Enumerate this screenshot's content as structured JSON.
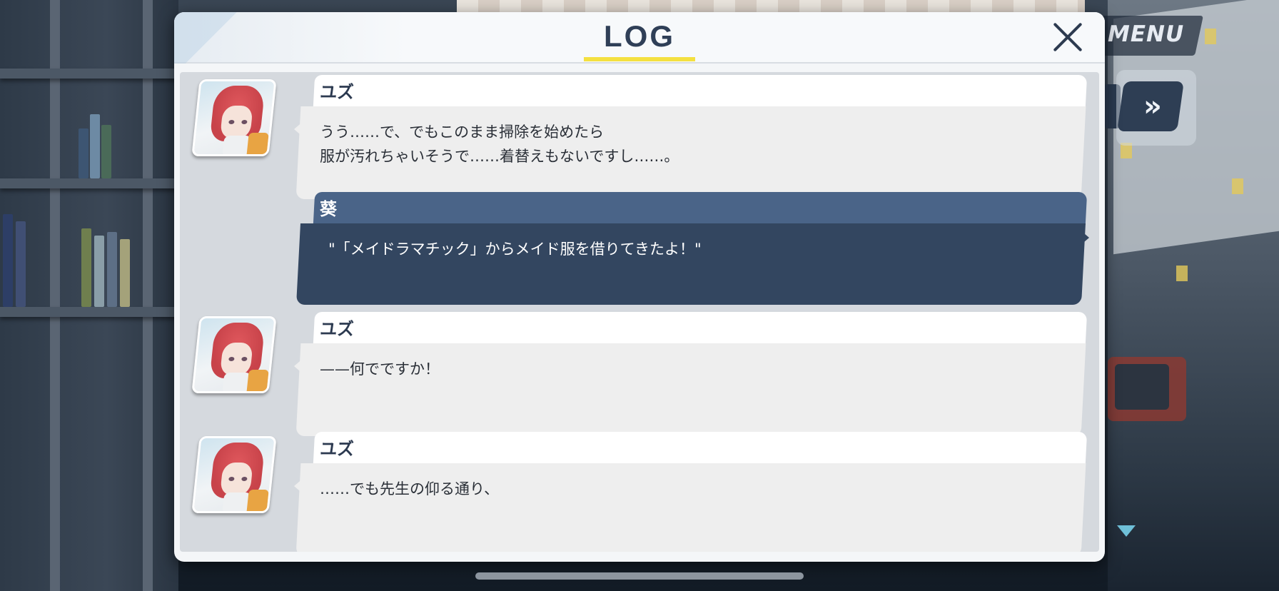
{
  "hud": {
    "menu_label": "MENU",
    "skip_icon": "fast-forward-icon",
    "next_indicator_icon": "next-triangle-icon"
  },
  "log": {
    "title": "LOG",
    "close_icon": "close-icon",
    "accent_color": "#f4e040",
    "entries": [
      {
        "speaker": "ユズ",
        "style": "character",
        "lines": [
          "うう……で、でもこのまま掃除を始めたら",
          "服が汚れちゃいそうで……着替えもないですし……。"
        ]
      },
      {
        "speaker": "葵",
        "style": "player",
        "lines": [
          "\"「メイドラマチック」からメイド服を借りてきたよ！\""
        ]
      },
      {
        "speaker": "ユズ",
        "style": "character",
        "lines": [
          "——何でですか！"
        ]
      },
      {
        "speaker": "ユズ",
        "style": "character",
        "lines": [
          "……でも先生の仰る通り、"
        ]
      }
    ]
  }
}
